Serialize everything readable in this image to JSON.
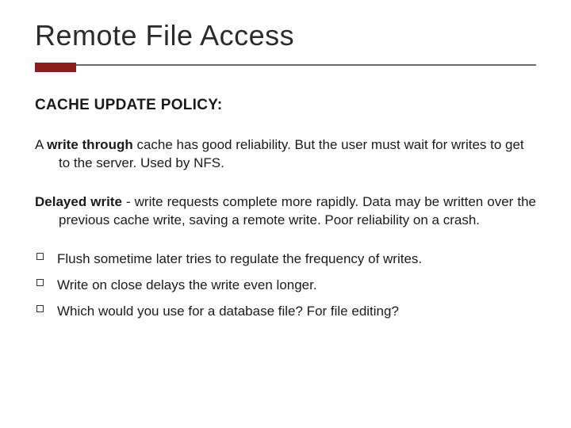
{
  "title": "Remote File Access",
  "subheading": "CACHE UPDATE POLICY:",
  "para1": {
    "lead": "A ",
    "bold": "write through",
    "rest": " cache has good reliability. But the user must wait for writes to get to the server. Used by NFS."
  },
  "para2": {
    "bold": "Delayed write",
    "rest": " - write requests complete more rapidly. Data may be written over the previous cache write, saving a remote write. Poor reliability on a crash."
  },
  "bullets": [
    "Flush sometime later tries to regulate the frequency of writes.",
    "Write on close delays the write even longer.",
    "Which would you use for a database file? For file editing?"
  ]
}
